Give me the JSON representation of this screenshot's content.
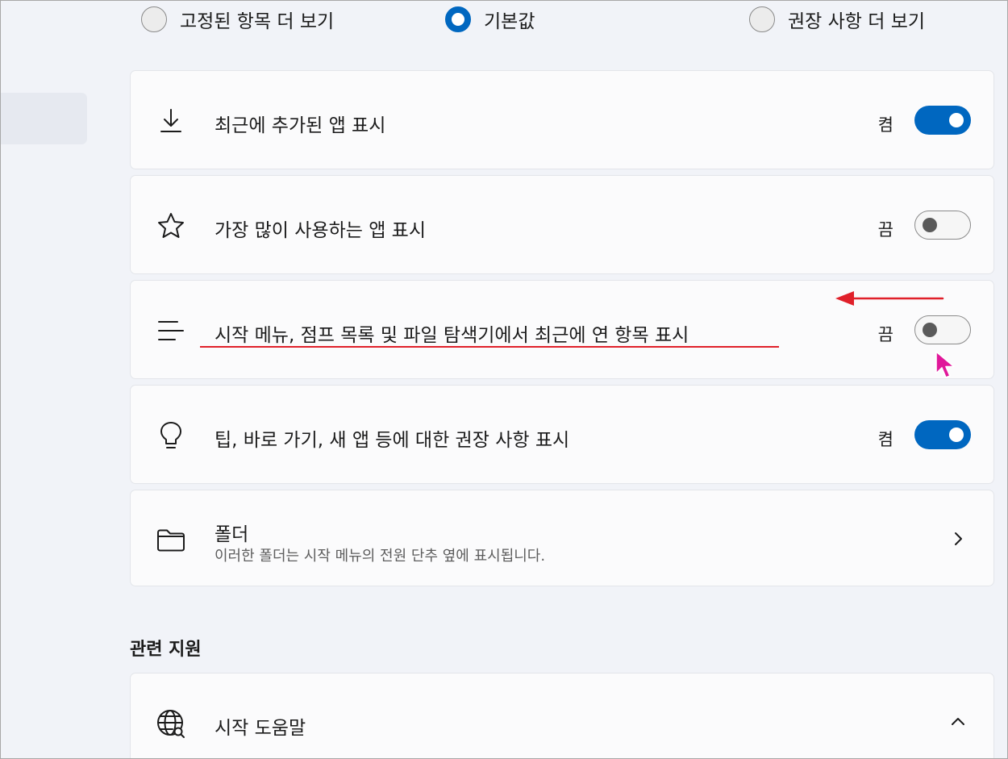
{
  "layout_options": [
    {
      "label": "고정된 항목 더 보기",
      "selected": false
    },
    {
      "label": "기본값",
      "selected": true
    },
    {
      "label": "권장 사항 더 보기",
      "selected": false
    }
  ],
  "settings": [
    {
      "icon": "download-icon",
      "title": "최근에 추가된 앱 표시",
      "state": "켬",
      "on": true
    },
    {
      "icon": "star-icon",
      "title": "가장 많이 사용하는 앱 표시",
      "state": "끔",
      "on": false
    },
    {
      "icon": "list-icon",
      "title": "시작 메뉴, 점프 목록 및 파일 탐색기에서 최근에 연 항목 표시",
      "state": "끔",
      "on": false
    },
    {
      "icon": "lightbulb-icon",
      "title": "팁, 바로 가기, 새 앱 등에 대한 권장 사항 표시",
      "state": "켬",
      "on": true
    }
  ],
  "folders": {
    "icon": "folder-icon",
    "title": "폴더",
    "subtitle": "이러한 폴더는 시작 메뉴의 전원 단추 옆에 표시됩니다."
  },
  "related_support": {
    "heading": "관련 지원",
    "item": {
      "icon": "globe-icon",
      "title": "시작 도움말"
    }
  },
  "colors": {
    "accent": "#0067c0",
    "annotation": "#e0202a",
    "cursor": "#e0189a"
  }
}
